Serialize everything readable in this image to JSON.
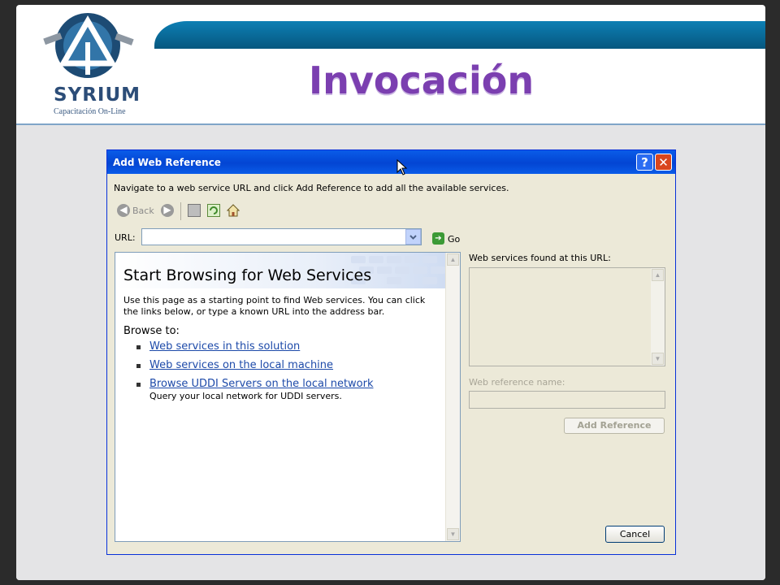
{
  "slide": {
    "logo_text": "SYRIUM",
    "logo_subtitle": "Capacitación On-Line",
    "title": "Invocación"
  },
  "dialog": {
    "title": "Add Web Reference",
    "help_label": "?",
    "close_label": "✕",
    "instructions": "Navigate to a web service URL and click Add Reference to add all the available services.",
    "toolbar": {
      "back_label": "Back"
    },
    "url_label": "URL:",
    "url_value": "",
    "go_label": "Go",
    "browser": {
      "banner_title": "Start Browsing for Web Services",
      "intro": "Use this page as a starting point to find Web services. You can click the links below, or type a known URL into the address bar.",
      "browse_to": "Browse to:",
      "links": [
        {
          "label": "Web services in this solution"
        },
        {
          "label": "Web services on the local machine"
        },
        {
          "label": "Browse UDDI Servers on the local network",
          "description": "Query your local network for UDDI servers."
        }
      ]
    },
    "found_label": "Web services found at this URL:",
    "refname_label": "Web reference name:",
    "refname_value": "",
    "add_reference_label": "Add Reference",
    "cancel_label": "Cancel"
  },
  "colors": {
    "title_purple": "#7b3fb0",
    "xp_blue": "#0345d3",
    "link_blue": "#1d4aa9"
  }
}
